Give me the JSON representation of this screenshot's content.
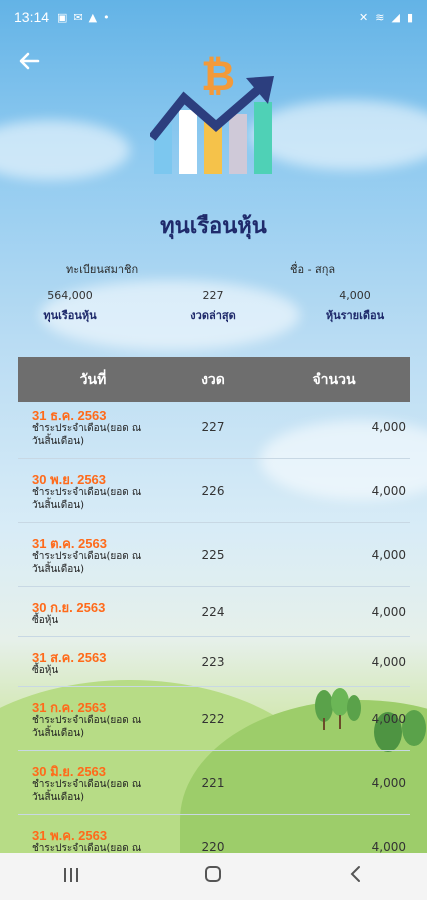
{
  "status": {
    "time": "13:14"
  },
  "page": {
    "title": "ทุนเรือนหุ้น"
  },
  "member": {
    "id_label": "ทะเบียนสมาชิก",
    "name_label": "ชื่อ - สกุล",
    "share_value": "564,000",
    "share_label": "ทุนเรือนหุ้น",
    "latest_period_value": "227",
    "latest_period_label": "งวดล่าสุด",
    "monthly_value": "4,000",
    "monthly_label": "หุ้นรายเดือน"
  },
  "table": {
    "headers": [
      "วันที่",
      "งวด",
      "จำนวน"
    ],
    "rows": [
      {
        "date": "31 ธ.ค. 2563",
        "desc": "ชำระประจำเดือน(ยอด ณ วันสิ้นเดือน)",
        "seq": "227",
        "amount": "4,000"
      },
      {
        "date": "30 พ.ย. 2563",
        "desc": "ชำระประจำเดือน(ยอด ณ วันสิ้นเดือน)",
        "seq": "226",
        "amount": "4,000"
      },
      {
        "date": "31 ต.ค. 2563",
        "desc": "ชำระประจำเดือน(ยอด ณ วันสิ้นเดือน)",
        "seq": "225",
        "amount": "4,000"
      },
      {
        "date": "30 ก.ย. 2563",
        "desc": "ซื้อหุ้น",
        "seq": "224",
        "amount": "4,000"
      },
      {
        "date": "31 ส.ค. 2563",
        "desc": "ซื้อหุ้น",
        "seq": "223",
        "amount": "4,000"
      },
      {
        "date": "31 ก.ค. 2563",
        "desc": "ชำระประจำเดือน(ยอด ณ วันสิ้นเดือน)",
        "seq": "222",
        "amount": "4,000"
      },
      {
        "date": "30 มิ.ย. 2563",
        "desc": "ชำระประจำเดือน(ยอด ณ วันสิ้นเดือน)",
        "seq": "221",
        "amount": "4,000"
      },
      {
        "date": "31 พ.ค. 2563",
        "desc": "ชำระประจำเดือน(ยอด ณ วันสิ้นเดือน)",
        "seq": "220",
        "amount": "4,000"
      }
    ]
  },
  "colors": {
    "accent_date": "#ff6a1a",
    "header_bg": "#6e6e6e",
    "title": "#1f2a6b"
  },
  "icons": {
    "back": "arrow-left-icon",
    "logo": "bitcoin-chart-logo-icon",
    "nav_recent": "recent-apps-icon",
    "nav_home": "home-icon",
    "nav_back": "back-icon"
  }
}
